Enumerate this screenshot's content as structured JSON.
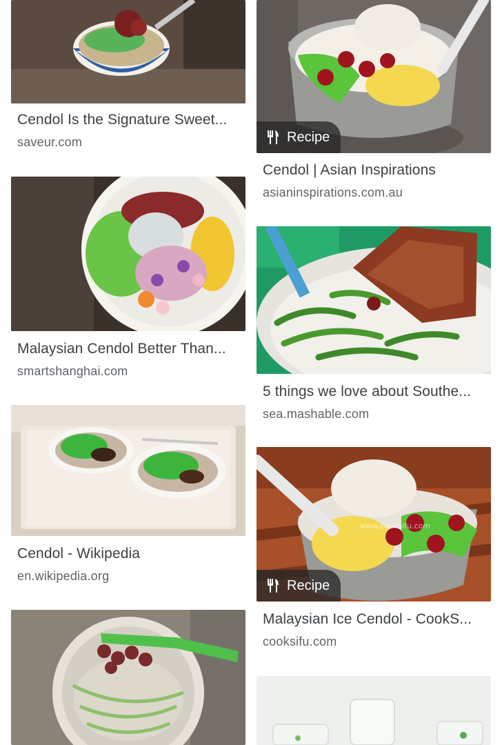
{
  "results": [
    {
      "title": "Cendol Is the Signature Sweet...",
      "source": "saveur.com"
    },
    {
      "title": "Cendol | Asian Inspirations",
      "source": "asianinspirations.com.au",
      "badge": "Recipe"
    },
    {
      "title": "Malaysian Cendol Better Than...",
      "source": "smartshanghai.com"
    },
    {
      "title": "5 things we love about Southe...",
      "source": "sea.mashable.com"
    },
    {
      "title": "Cendol - Wikipedia",
      "source": "en.wikipedia.org"
    },
    {
      "title": "Malaysian Ice Cendol - CookS...",
      "source": "cooksifu.com",
      "badge": "Recipe"
    },
    {
      "watermark": "www.cooksifu.com"
    }
  ],
  "icons": {
    "recipe": "fork-knife-icon"
  },
  "colors": {
    "title": "#3c4043",
    "source": "#5f6368",
    "badge_bg": "#282828"
  }
}
